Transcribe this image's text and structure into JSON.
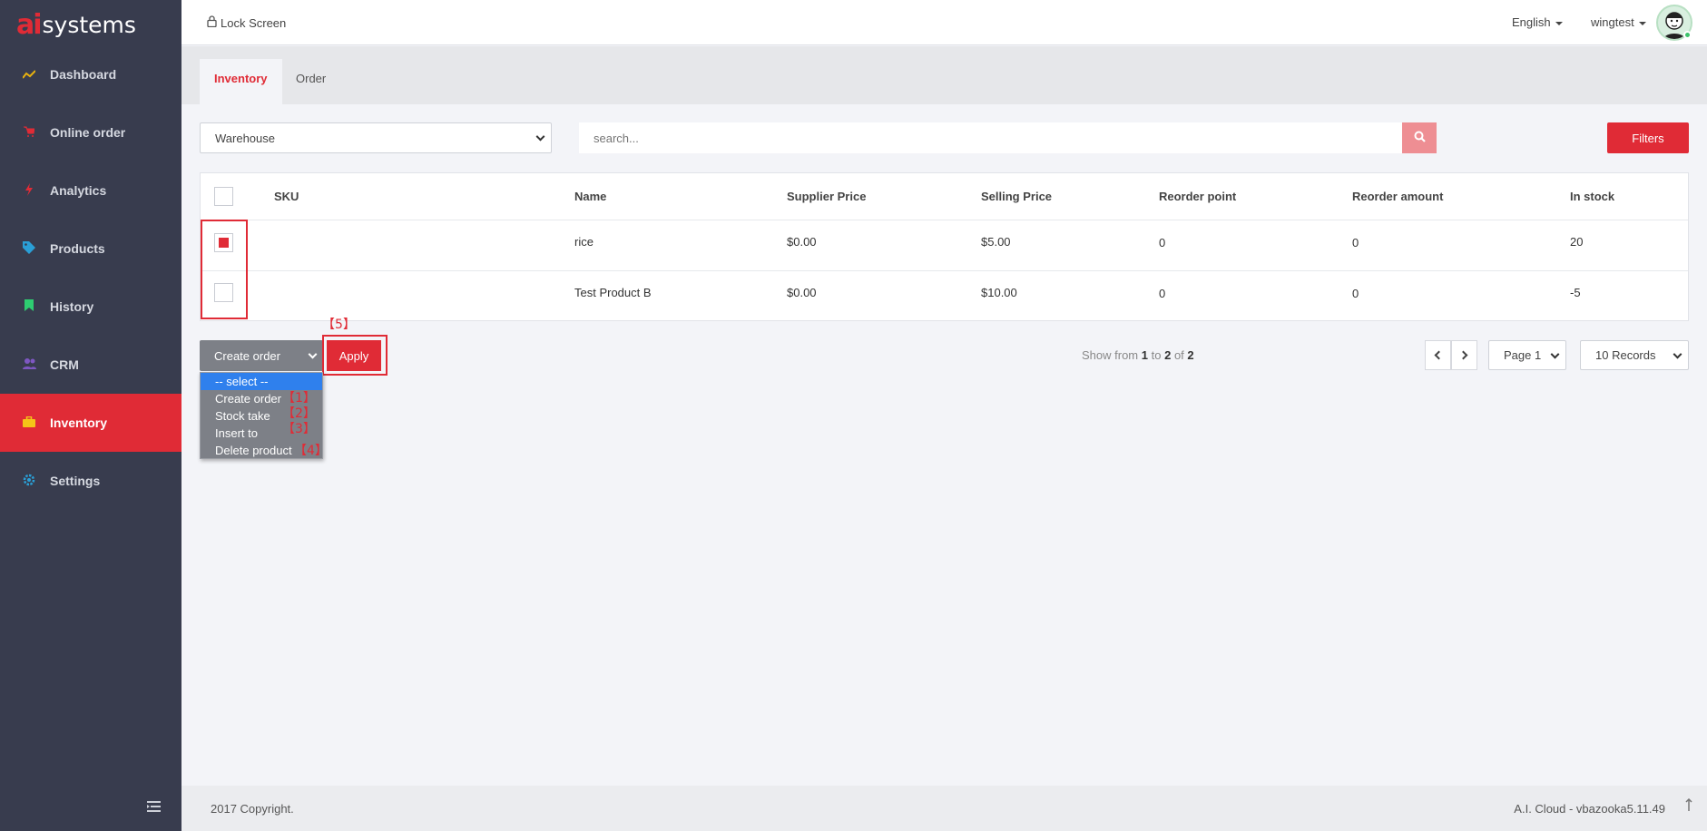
{
  "brand": {
    "mark": "ai",
    "name": "systems"
  },
  "sidebar": {
    "items": [
      {
        "label": "Dashboard",
        "icon": "chart-line-icon",
        "color": "#e9b20e"
      },
      {
        "label": "Online order",
        "icon": "cart-icon",
        "color": "#e02b36"
      },
      {
        "label": "Analytics",
        "icon": "bolt-icon",
        "color": "#e02b36"
      },
      {
        "label": "Products",
        "icon": "tag-icon",
        "color": "#2a9fd6"
      },
      {
        "label": "History",
        "icon": "bookmark-icon",
        "color": "#2ecc71"
      },
      {
        "label": "CRM",
        "icon": "users-icon",
        "color": "#7e57c2"
      },
      {
        "label": "Inventory",
        "icon": "briefcase-icon",
        "color": "#f5c518"
      },
      {
        "label": "Settings",
        "icon": "gear-icon",
        "color": "#2a9fd6"
      }
    ],
    "active": "Inventory"
  },
  "topbar": {
    "lock_label": "Lock Screen",
    "language": "English",
    "username": "wingtest"
  },
  "tabs": [
    {
      "label": "Inventory",
      "active": true
    },
    {
      "label": "Order",
      "active": false
    }
  ],
  "controls": {
    "warehouse_selected": "Warehouse",
    "search_placeholder": "search...",
    "filters_label": "Filters"
  },
  "table": {
    "columns": [
      "SKU",
      "Name",
      "Supplier Price",
      "Selling Price",
      "Reorder point",
      "Reorder amount",
      "In stock"
    ],
    "rows": [
      {
        "checked": true,
        "sku": "",
        "name": "rice",
        "supplier_price": "$0.00",
        "selling_price": "$5.00",
        "reorder_point": "0",
        "reorder_amount": "0",
        "in_stock": "20"
      },
      {
        "checked": false,
        "sku": "",
        "name": "Test Product B",
        "supplier_price": "$0.00",
        "selling_price": "$10.00",
        "reorder_point": "0",
        "reorder_amount": "0",
        "in_stock": "-5"
      }
    ]
  },
  "actions": {
    "selected": "Create order",
    "apply_label": "Apply",
    "options": [
      {
        "label": "-- select --",
        "marker": ""
      },
      {
        "label": "Create order",
        "marker": "【1】"
      },
      {
        "label": "Stock take",
        "marker": "【2】"
      },
      {
        "label": "Insert to",
        "marker": "【3】"
      },
      {
        "label": "Delete product",
        "marker": "【4】"
      }
    ],
    "apply_marker": "【5】"
  },
  "pagination": {
    "show_prefix": "Show from",
    "from": "1",
    "to_word": "to",
    "to": "2",
    "of_word": "of",
    "total": "2",
    "page_selected": "Page 1",
    "records_selected": "10 Records"
  },
  "footer": {
    "copyright": "2017 Copyright.",
    "version": "A.I. Cloud - vbazooka5.11.49"
  },
  "colors": {
    "accent": "#e02b36",
    "sidebar_bg": "#383c4e"
  }
}
